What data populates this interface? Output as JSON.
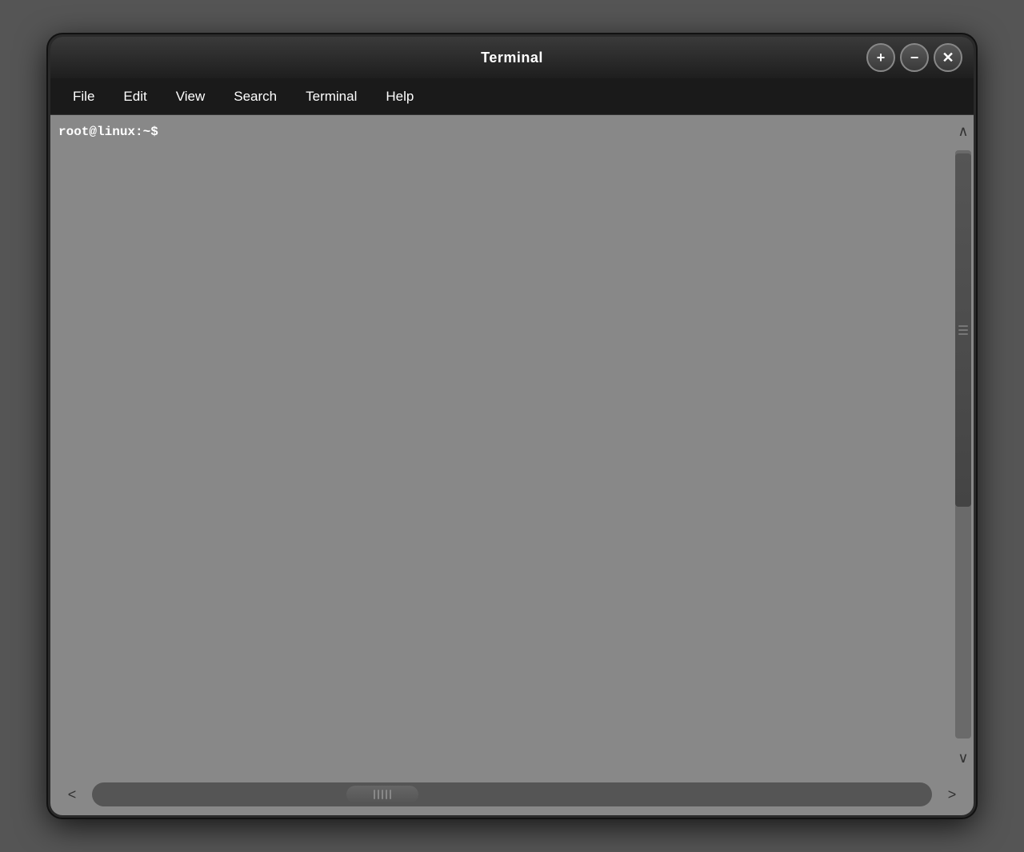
{
  "titlebar": {
    "title": "Terminal",
    "controls": {
      "add_label": "+",
      "minimize_label": "−",
      "close_label": "✕"
    }
  },
  "menubar": {
    "items": [
      {
        "id": "file",
        "label": "File"
      },
      {
        "id": "edit",
        "label": "Edit"
      },
      {
        "id": "view",
        "label": "View"
      },
      {
        "id": "search",
        "label": "Search"
      },
      {
        "id": "terminal",
        "label": "Terminal"
      },
      {
        "id": "help",
        "label": "Help"
      }
    ]
  },
  "terminal": {
    "prompt": "root@linux:~$"
  },
  "scrollbar": {
    "up_arrow": "∧",
    "down_arrow": "∨",
    "left_arrow": "<",
    "right_arrow": ">"
  }
}
